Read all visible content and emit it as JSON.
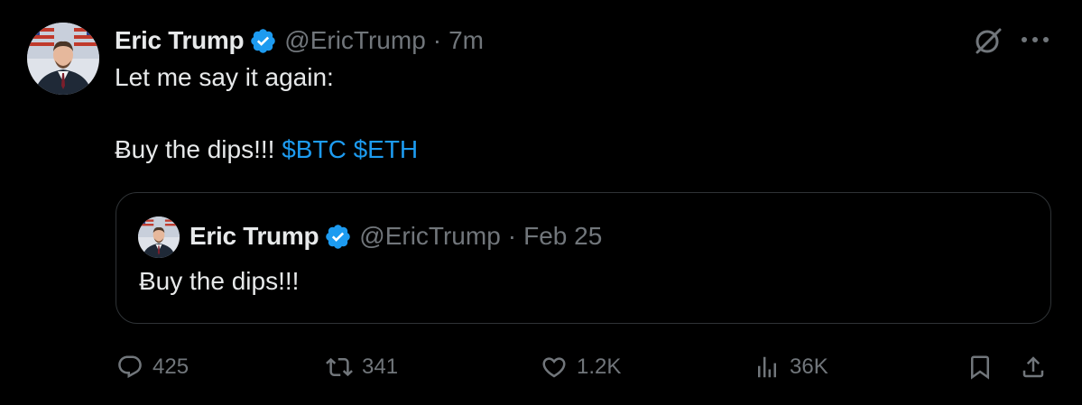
{
  "tweet": {
    "author": {
      "display_name": "Eric Trump",
      "handle": "@EricTrump",
      "verified_icon": "verified-badge-icon"
    },
    "separator": "·",
    "time": "7m",
    "text_line1": "Let me say it again:",
    "text_line2_prefix": "Ƀuy the dips!!! ",
    "cashtags": [
      "$BTC",
      "$ETH"
    ],
    "icons": {
      "grok": "grok-icon",
      "more": "more-icon"
    }
  },
  "quote": {
    "author": {
      "display_name": "Eric Trump",
      "handle": "@EricTrump"
    },
    "separator": "·",
    "date": "Feb 25",
    "text": "Ƀuy the dips!!!"
  },
  "actions": {
    "replies": "425",
    "reposts": "341",
    "likes": "1.2K",
    "views": "36K"
  },
  "colors": {
    "background": "#000000",
    "text": "#e7e9ea",
    "muted": "#71767b",
    "accent": "#1d9bf0",
    "border": "#2f3336"
  }
}
